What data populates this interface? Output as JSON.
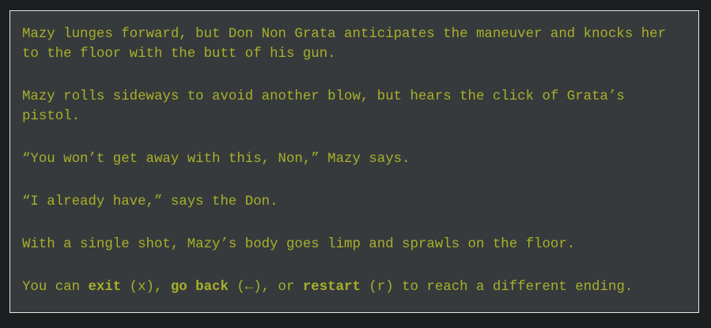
{
  "story": {
    "paragraphs": [
      "Mazy lunges forward, but Don Non Grata anticipates the maneuver and knocks her to the floor with the butt of his gun.",
      "Mazy rolls sideways to avoid another blow, but hears the click of Grata’s pistol.",
      "“You won’t get away with this, Non,” Mazy says.",
      "“I already have,” says the Don.",
      "With a single shot, Mazy’s body goes limp and sprawls on the floor."
    ],
    "ending": {
      "prefix": "You can ",
      "exit_label": "exit",
      "exit_key": " (x), ",
      "back_label": "go back",
      "back_key": " (←), or ",
      "restart_label": "restart",
      "suffix": " (r) to reach a different ending."
    }
  },
  "colors": {
    "text": "#a8b02a",
    "panel": "#363a3c",
    "background": "#1c1f20"
  }
}
